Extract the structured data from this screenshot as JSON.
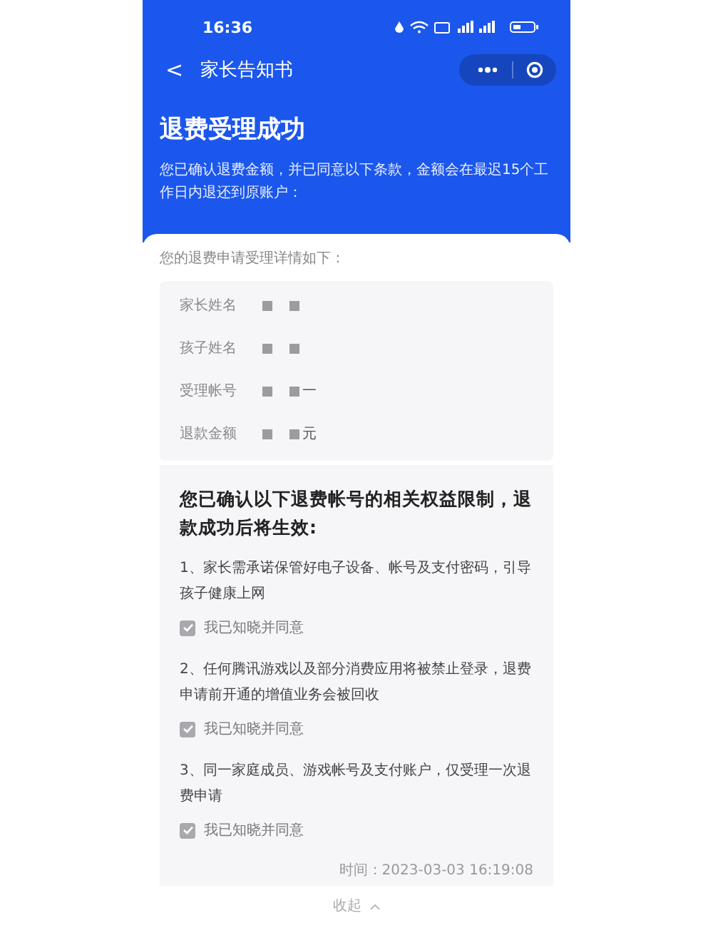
{
  "status_bar": {
    "time": "16:36"
  },
  "nav": {
    "back": "<",
    "title": "家长告知书"
  },
  "header": {
    "title": "退费受理成功",
    "description": "您已确认退费金额，并已同意以下条款，金额会在最迟15个工作日内退还到原账户："
  },
  "details": {
    "intro": "您的退费申请受理详情如下：",
    "rows": [
      {
        "label": "家长姓名",
        "value": ""
      },
      {
        "label": "孩子姓名",
        "value": ""
      },
      {
        "label": "受理帐号",
        "value": "一"
      },
      {
        "label": "退款金额",
        "value": "元"
      }
    ]
  },
  "terms": {
    "title": "您已确认以下退费帐号的相关权益限制，退款成功后将生效:",
    "items": [
      {
        "text": "1、家长需承诺保管好电子设备、帐号及支付密码，引导孩子健康上网",
        "agree": "我已知晓并同意",
        "checked": true
      },
      {
        "text": "2、任何腾讯游戏以及部分消费应用将被禁止登录，退费申请前开通的增值业务会被回收",
        "agree": "我已知晓并同意",
        "checked": true
      },
      {
        "text": "3、同一家庭成员、游戏帐号及支付账户，仅受理一次退费申请",
        "agree": "我已知晓并同意",
        "checked": true
      }
    ],
    "time": "时间：2023-03-03 16:19:08",
    "collapse": "收起"
  }
}
